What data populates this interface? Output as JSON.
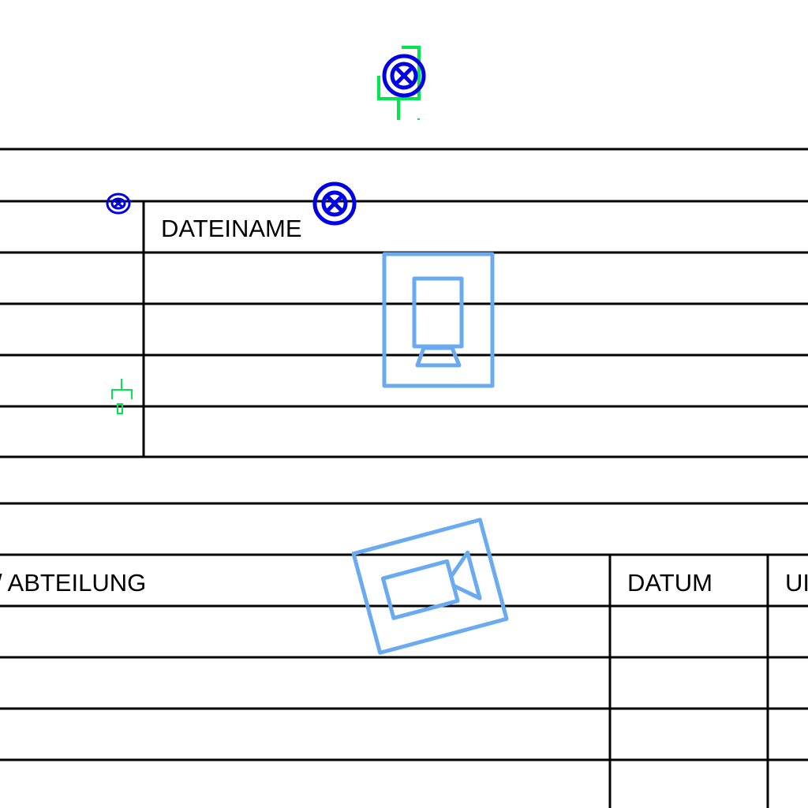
{
  "drawing": {
    "upper_block": {
      "filename_header": "DATEINAME"
    },
    "lower_block": {
      "department_header": "/ ABTEILUNG",
      "date_header": "DATUM",
      "third_header_partial": "UI"
    }
  },
  "symbols": [
    {
      "name": "crossed-circle-lamp-icon",
      "color": "#0000e6"
    },
    {
      "name": "small-crossed-circle-lamp-icon",
      "color": "#0000e6"
    },
    {
      "name": "switch-plug-icon",
      "color": "#00e64c"
    },
    {
      "name": "monitor-display-icon",
      "color": "#6aaaf0"
    },
    {
      "name": "video-camera-icon",
      "color": "#6aaaf0"
    }
  ],
  "colors": {
    "lines": "#000000",
    "lamp_symbol": "#0000e6",
    "switch_symbol": "#00e64c",
    "device_symbol": "#6aaaf0"
  }
}
